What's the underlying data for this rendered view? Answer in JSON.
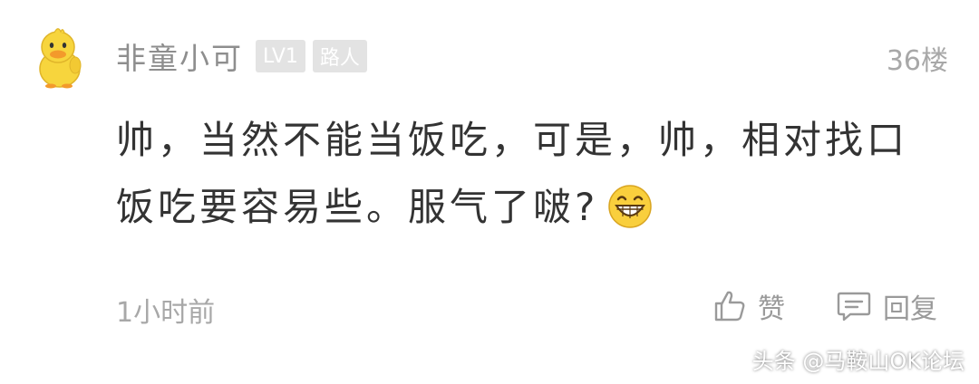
{
  "comment": {
    "username": "非童小可",
    "level_badge": "LV1",
    "role_badge": "路人",
    "floor": "36楼",
    "content_line1": "帅，当然不能当饭吃，可是，帅，相对找口",
    "content_line2": "饭吃要容易些。服气了啵?",
    "emoji": "grinning-face-icon",
    "time": "1小时前"
  },
  "actions": {
    "like_label": "赞",
    "reply_label": "回复"
  },
  "watermark": "头条 @马鞍山OK论坛",
  "colors": {
    "username": "#8e8e8e",
    "content": "#333333",
    "meta": "#a8a8a8",
    "badge_bg": "#e3e3e3",
    "avatar_yellow": "#f7d53d"
  }
}
